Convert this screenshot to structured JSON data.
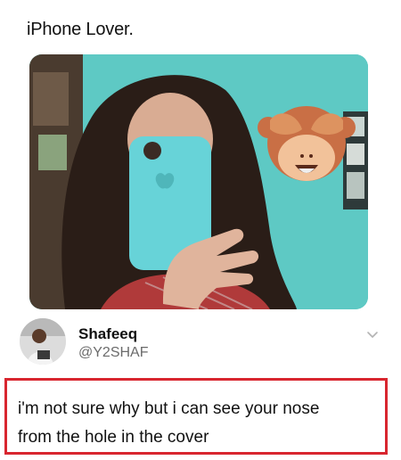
{
  "post": {
    "caption": "iPhone Lover."
  },
  "tweet": {
    "author_name": "Shafeeq",
    "author_handle": "@Y2SHAF",
    "text_line1": "i'm not sure why but i can see your nose",
    "text_line2": "from the hole in the cover"
  },
  "colors": {
    "phone_case": "#67d3d8",
    "wall": "#5ec9c4",
    "highlight_border": "#d8262f",
    "handle": "#6b6b6b"
  },
  "icons": {
    "emoji": "see-no-evil-monkey",
    "menu": "chevron-down"
  }
}
